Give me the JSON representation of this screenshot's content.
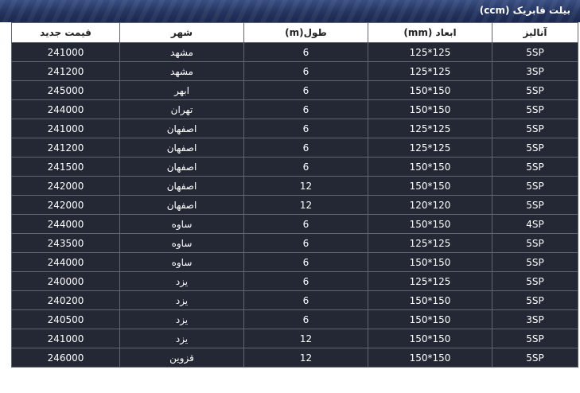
{
  "header": {
    "title": "بیلت فابریک (ccm)"
  },
  "table": {
    "columns": [
      "آنالیز",
      "ابعاد (mm)",
      "طول(m)",
      "شهر",
      "قیمت جدید"
    ],
    "rows": [
      {
        "analysis": "5SP",
        "dimensions": "125*125",
        "length": "6",
        "city": "مشهد",
        "price": "241000"
      },
      {
        "analysis": "3SP",
        "dimensions": "125*125",
        "length": "6",
        "city": "مشهد",
        "price": "241200"
      },
      {
        "analysis": "5SP",
        "dimensions": "150*150",
        "length": "6",
        "city": "ابهر",
        "price": "245000"
      },
      {
        "analysis": "5SP",
        "dimensions": "150*150",
        "length": "6",
        "city": "تهران",
        "price": "244000"
      },
      {
        "analysis": "5SP",
        "dimensions": "125*125",
        "length": "6",
        "city": "اصفهان",
        "price": "241000"
      },
      {
        "analysis": "5SP",
        "dimensions": "125*125",
        "length": "6",
        "city": "اصفهان",
        "price": "241200"
      },
      {
        "analysis": "5SP",
        "dimensions": "150*150",
        "length": "6",
        "city": "اصفهان",
        "price": "241500"
      },
      {
        "analysis": "5SP",
        "dimensions": "150*150",
        "length": "12",
        "city": "اصفهان",
        "price": "242000"
      },
      {
        "analysis": "5SP",
        "dimensions": "120*120",
        "length": "12",
        "city": "اصفهان",
        "price": "242000"
      },
      {
        "analysis": "4SP",
        "dimensions": "150*150",
        "length": "6",
        "city": "ساوه",
        "price": "244000"
      },
      {
        "analysis": "5SP",
        "dimensions": "125*125",
        "length": "6",
        "city": "ساوه",
        "price": "243500"
      },
      {
        "analysis": "5SP",
        "dimensions": "150*150",
        "length": "6",
        "city": "ساوه",
        "price": "244000"
      },
      {
        "analysis": "5SP",
        "dimensions": "125*125",
        "length": "6",
        "city": "یزد",
        "price": "240000"
      },
      {
        "analysis": "5SP",
        "dimensions": "150*150",
        "length": "6",
        "city": "یزد",
        "price": "240200"
      },
      {
        "analysis": "3SP",
        "dimensions": "150*150",
        "length": "6",
        "city": "یزد",
        "price": "240500"
      },
      {
        "analysis": "5SP",
        "dimensions": "150*150",
        "length": "12",
        "city": "یزد",
        "price": "241000"
      },
      {
        "analysis": "5SP",
        "dimensions": "150*150",
        "length": "12",
        "city": "قزوین",
        "price": "246000"
      }
    ]
  },
  "colors": {
    "title_bar": "#24345f",
    "row_background": "#232834",
    "header_background": "#ffffff",
    "border": "#5e6670"
  }
}
